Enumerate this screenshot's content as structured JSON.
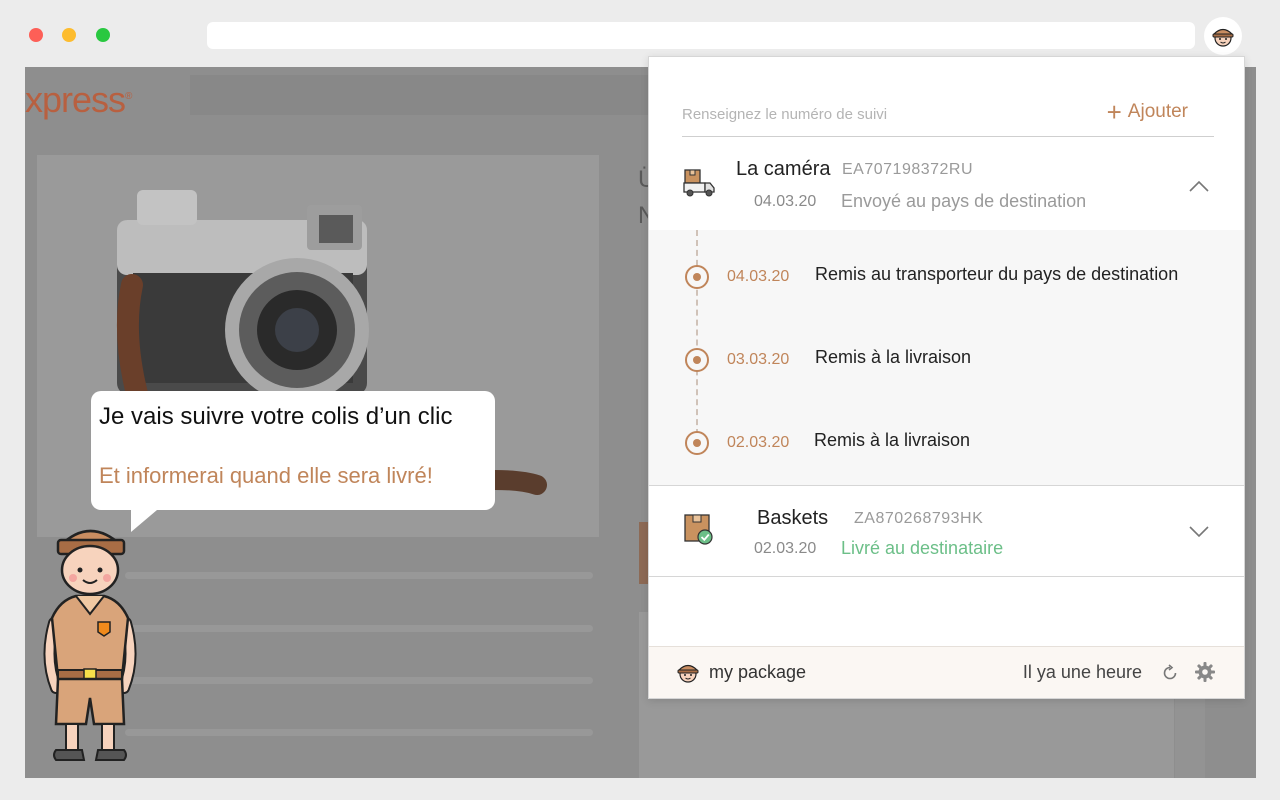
{
  "page": {
    "logo_text": "xpress",
    "logo_mark": "®"
  },
  "popup": {
    "search": {
      "placeholder": "Renseignez le numéro de suivi"
    },
    "add_label": "Ajouter",
    "packages": [
      {
        "name": "La caméra",
        "code": "EA707198372RU",
        "date": "04.03.20",
        "status": "Envoyé au pays de destination",
        "expanded": true,
        "icon": "delivery-truck-icon",
        "events": [
          {
            "date": "04.03.20",
            "text": "Remis au transporteur du pays de destination"
          },
          {
            "date": "03.03.20",
            "text": "Remis à la livraison"
          },
          {
            "date": "02.03.20",
            "text": "Remis à la livraison"
          }
        ]
      },
      {
        "name": "Baskets",
        "code": "ZA870268793HK",
        "date": "02.03.20",
        "status": "Livré au destinataire",
        "expanded": false,
        "icon": "delivered-box-icon"
      }
    ],
    "footer": {
      "brand": "my package",
      "updated": "Il ya une heure"
    }
  },
  "bubble": {
    "title": "Je vais suivre votre colis d’un clic",
    "subtitle": "Et informerai quand elle sera livré!"
  },
  "colors": {
    "accent": "#c0855a",
    "delivered": "#6cbf88"
  }
}
